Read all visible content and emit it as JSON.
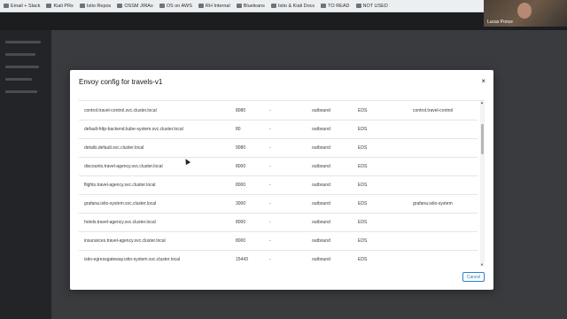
{
  "bookmarks": [
    {
      "label": "Email + Slack",
      "icon": "folder-icon"
    },
    {
      "label": "Kiali PRs",
      "icon": "folder-icon"
    },
    {
      "label": "Istio Repos",
      "icon": "folder-icon"
    },
    {
      "label": "OSSM JIRAs",
      "icon": "folder-icon"
    },
    {
      "label": "OS on AWS",
      "icon": "folder-icon"
    },
    {
      "label": "RH Internal",
      "icon": "folder-icon"
    },
    {
      "label": "Blueleans",
      "icon": "folder-icon"
    },
    {
      "label": "Istio & Kiali Docs",
      "icon": "folder-icon"
    },
    {
      "label": "TO READ",
      "icon": "folder-icon"
    },
    {
      "label": "NOT USED",
      "icon": "folder-icon"
    }
  ],
  "video": {
    "name": "Lucas Ponce"
  },
  "modal": {
    "title": "Envoy config for travels-v1",
    "close_label": "×",
    "rows": [
      [
        "control.travel-control.svc.cluster.local",
        "8080",
        "-",
        "outbound",
        "EDS",
        "control.travel-control"
      ],
      [
        "default-http-backend.kube-system.svc.cluster.local",
        "80",
        "-",
        "outbound",
        "EDS",
        ""
      ],
      [
        "details.default.svc.cluster.local",
        "9080",
        "-",
        "outbound",
        "EDS",
        ""
      ],
      [
        "discounts.travel-agency.svc.cluster.local",
        "8000",
        "-",
        "outbound",
        "EDS",
        ""
      ],
      [
        "flights.travel-agency.svc.cluster.local",
        "8000",
        "-",
        "outbound",
        "EDS",
        ""
      ],
      [
        "grafana.istio-system.svc.cluster.local",
        "3000",
        "-",
        "outbound",
        "EDS",
        "grafana.istio-system"
      ],
      [
        "hotels.travel-agency.svc.cluster.local",
        "8000",
        "-",
        "outbound",
        "EDS",
        ""
      ],
      [
        "insurances.travel-agency.svc.cluster.local",
        "8000",
        "-",
        "outbound",
        "EDS",
        ""
      ],
      [
        "istio-egressgateway.istio-system.svc.cluster.local",
        "15443",
        "-",
        "outbound",
        "EDS",
        ""
      ]
    ],
    "cancel_label": "Cancel"
  },
  "colors": {
    "accent": "#2b82c8",
    "overlay": "#2a2b2e"
  }
}
